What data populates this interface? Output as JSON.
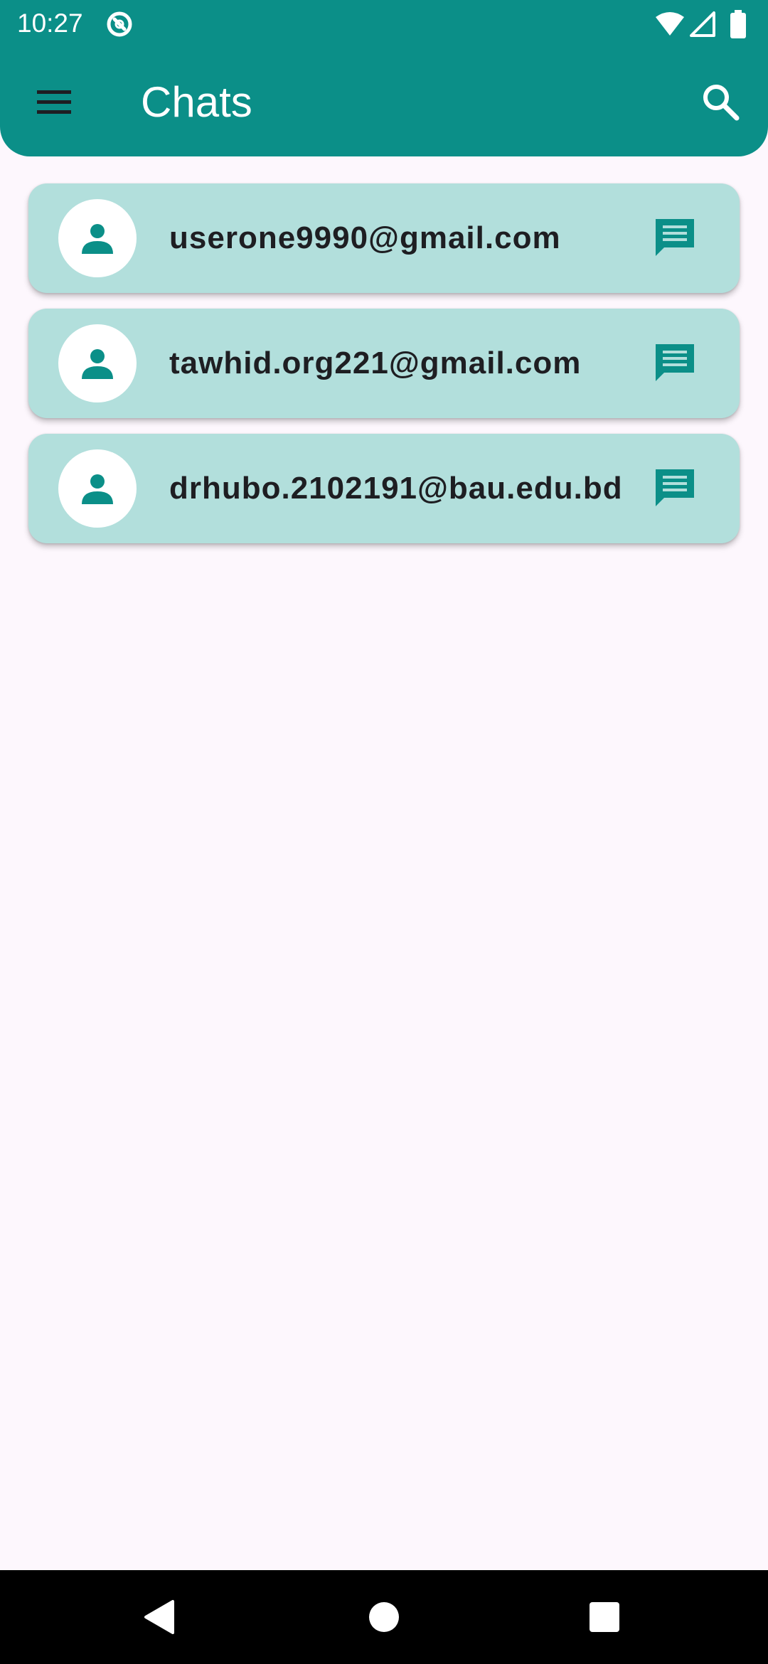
{
  "status_bar": {
    "time": "10:27",
    "icons": [
      "app-notification-icon",
      "wifi-icon",
      "cell-signal-icon",
      "battery-icon"
    ]
  },
  "app_bar": {
    "title": "Chats",
    "menu_icon": "hamburger-menu-icon",
    "search_icon": "search-icon"
  },
  "chats": [
    {
      "email": "userone9990@gmail.com",
      "avatar_icon": "person-icon",
      "action_icon": "chat-bubble-icon"
    },
    {
      "email": "tawhid.org221@gmail.com",
      "avatar_icon": "person-icon",
      "action_icon": "chat-bubble-icon"
    },
    {
      "email": "drhubo.2102191@bau.edu.bd",
      "avatar_icon": "person-icon",
      "action_icon": "chat-bubble-icon"
    }
  ],
  "nav_bar": {
    "buttons": [
      "back-icon",
      "home-icon",
      "recents-icon"
    ]
  },
  "colors": {
    "primary": "#0B8F88",
    "card_background": "#B2DFDC",
    "page_background": "#FDF7FD",
    "text": "#1E1E22"
  }
}
